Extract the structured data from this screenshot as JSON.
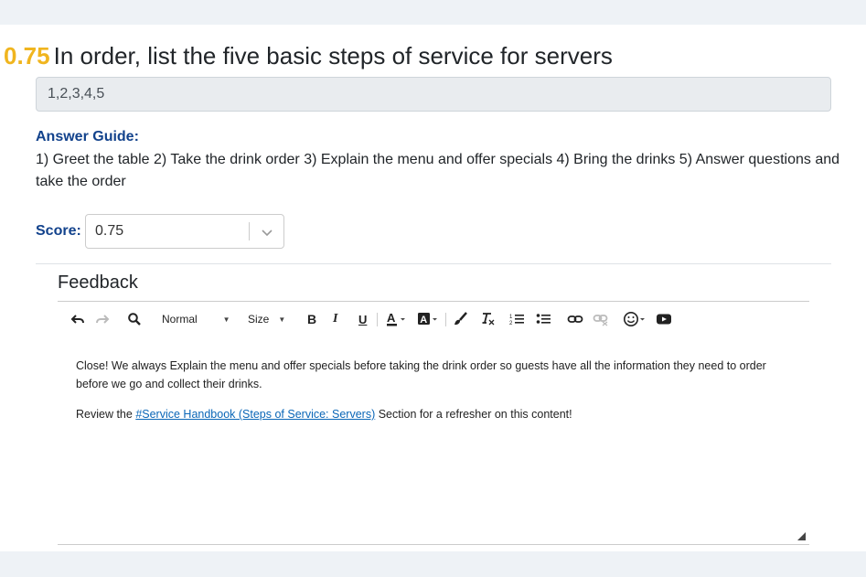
{
  "question": {
    "score": "0.75",
    "title": "In order, list the five basic steps of service for servers"
  },
  "answer": {
    "value": "1,2,3,4,5"
  },
  "answer_guide": {
    "label": "Answer Guide:",
    "text": "1) Greet the table 2) Take the drink order 3) Explain the menu and offer specials 4) Bring the drinks 5) Answer questions and take the order"
  },
  "score": {
    "label": "Score:",
    "selected": "0.75"
  },
  "feedback": {
    "title": "Feedback",
    "toolbar": {
      "format_label": "Normal",
      "size_label": "Size",
      "bold": "B",
      "italic": "I",
      "underline": "U"
    },
    "body": {
      "paragraph1": "Close! We always Explain the menu and offer specials before taking the drink order so guests have all the information they need to order before we go and collect their drinks.",
      "p2_before": "Review the ",
      "p2_link": "#Service Handbook (Steps of Service: Servers)",
      "p2_after": " Section for a refresher on this content!"
    }
  },
  "colors": {
    "score_accent": "#f0b51f",
    "label_blue": "#12428c",
    "link_blue": "#0a66b7"
  },
  "icons": [
    "undo-icon",
    "redo-icon",
    "search-icon",
    "font-color-icon",
    "background-color-icon",
    "copy-format-icon",
    "remove-format-icon",
    "numbered-list-icon",
    "bulleted-list-icon",
    "link-icon",
    "unlink-icon",
    "emoji-icon",
    "youtube-icon",
    "chevron-down-icon",
    "resize-grip-icon"
  ]
}
